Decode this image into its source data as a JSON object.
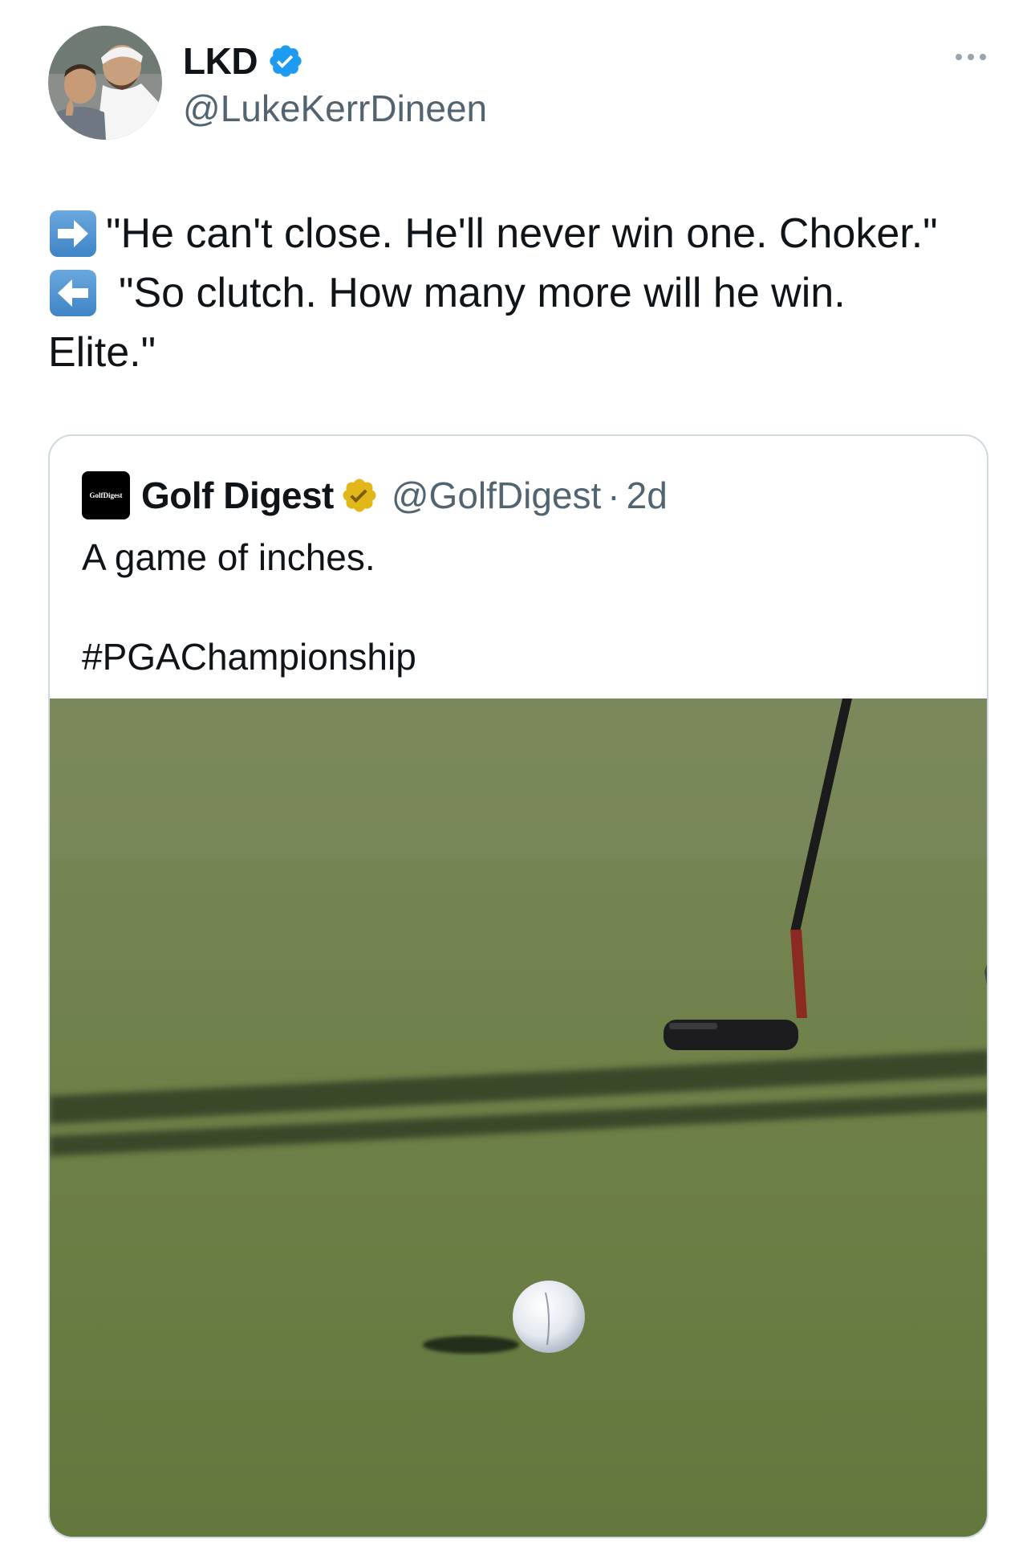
{
  "author": {
    "display_name": "LKD",
    "handle": "@LukeKerrDineen",
    "verified": "blue-check-icon"
  },
  "tweet": {
    "line1": "\"He can't close. He'll never win one. Choker.\"",
    "line2": "\"So clutch. How many more will he win.",
    "line3": "Elite.\"",
    "emoji1": "right-arrow-emoji",
    "emoji2": "left-arrow-emoji"
  },
  "quote": {
    "logo_text": "GolfDigest",
    "display_name": "Golf Digest",
    "verified": "gold-check-icon",
    "handle": "@GolfDigest",
    "separator": "·",
    "time": "2d",
    "text_line1": "A game of inches.",
    "hashtag": "#PGAChampionship",
    "media": "golf-putt-photo"
  },
  "colors": {
    "text": "#0f1419",
    "secondary": "#536471",
    "verified_blue": "#1d9bf0",
    "gold": "#e2b719",
    "border": "#cfd9de"
  }
}
